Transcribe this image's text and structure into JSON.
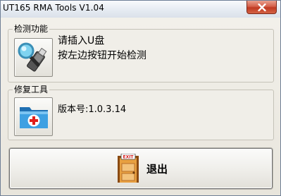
{
  "window": {
    "title": "UT165 RMA Tools  V1.04",
    "close_label": "close"
  },
  "detect_group": {
    "legend": "检测功能",
    "line1": "请插入U盘",
    "line2": "按左边按钮开始检测",
    "button_icon": "magnifier-usb-icon"
  },
  "repair_group": {
    "legend": "修复工具",
    "version": "版本号:1.0.3.14",
    "button_icon": "first-aid-folder-icon"
  },
  "exit_button": {
    "label": "退出",
    "sign_text": "EXIT",
    "icon": "exit-door-icon"
  },
  "colors": {
    "close_red": "#c9442c",
    "folder_blue": "#2f8fd6",
    "door_orange": "#d98a2b"
  }
}
